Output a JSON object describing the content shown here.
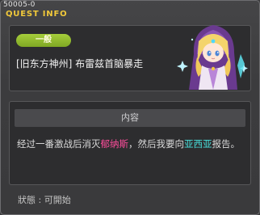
{
  "window": {
    "quest_id": "50005-0",
    "title": "QUEST INFO"
  },
  "quest": {
    "category": "一般",
    "name": "[旧东方神州] 布雷兹首脑暴走"
  },
  "content": {
    "header": "内容",
    "description_parts": [
      {
        "text": "经过一番激战后消灭",
        "style": "normal"
      },
      {
        "text": "郁纳斯",
        "style": "pink"
      },
      {
        "text": "，然后我要向",
        "style": "normal"
      },
      {
        "text": "亚西亚",
        "style": "cyan"
      },
      {
        "text": "报告。",
        "style": "normal"
      }
    ]
  },
  "status": {
    "text": "狀態 : 可開始"
  },
  "colors": {
    "title": "#f1c93a",
    "badge": "#8fb82b",
    "highlight_pink": "#ff4d9c",
    "highlight_cyan": "#48e0dc"
  },
  "icons": {
    "portrait": "npc-portrait-blonde-mage"
  }
}
